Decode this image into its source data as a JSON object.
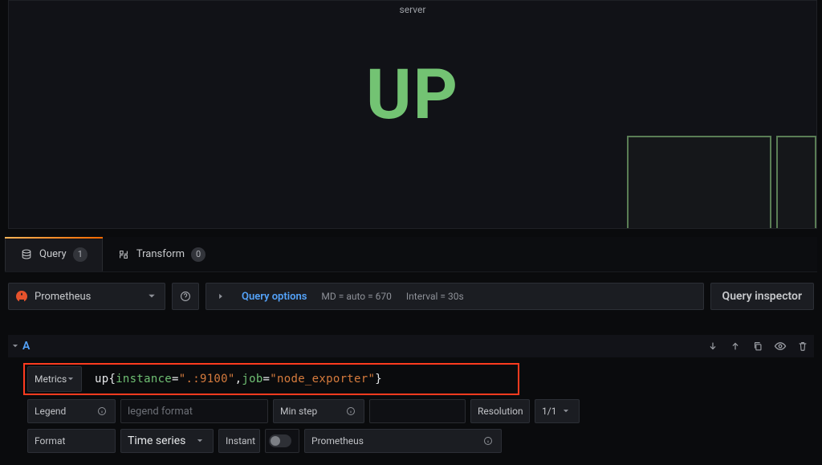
{
  "panel": {
    "title": "server",
    "big_value": "UP"
  },
  "tabs": {
    "query": {
      "label": "Query",
      "count": "1"
    },
    "transform": {
      "label": "Transform",
      "count": "0"
    }
  },
  "datasource": {
    "name": "Prometheus"
  },
  "query_options": {
    "toggle_label": "Query options",
    "meta_md": "MD = auto = 670",
    "meta_interval": "Interval = 30s"
  },
  "inspector_label": "Query inspector",
  "query": {
    "name": "A",
    "metrics_label": "Metrics",
    "text": {
      "fn": "up",
      "k_instance": "instance",
      "v_instance_pre": "\".",
      "v_instance_redacted": "      ",
      "v_instance_suf": ":9100\"",
      "k_job": "job",
      "v_job": "\"node_exporter\""
    }
  },
  "legend": {
    "label": "Legend",
    "placeholder": "legend format"
  },
  "minstep": {
    "label": "Min step"
  },
  "resolution": {
    "label": "Resolution",
    "value": "1/1"
  },
  "format": {
    "label": "Format",
    "value": "Time series"
  },
  "instant": {
    "label": "Instant"
  },
  "prometheus": {
    "label": "Prometheus"
  }
}
